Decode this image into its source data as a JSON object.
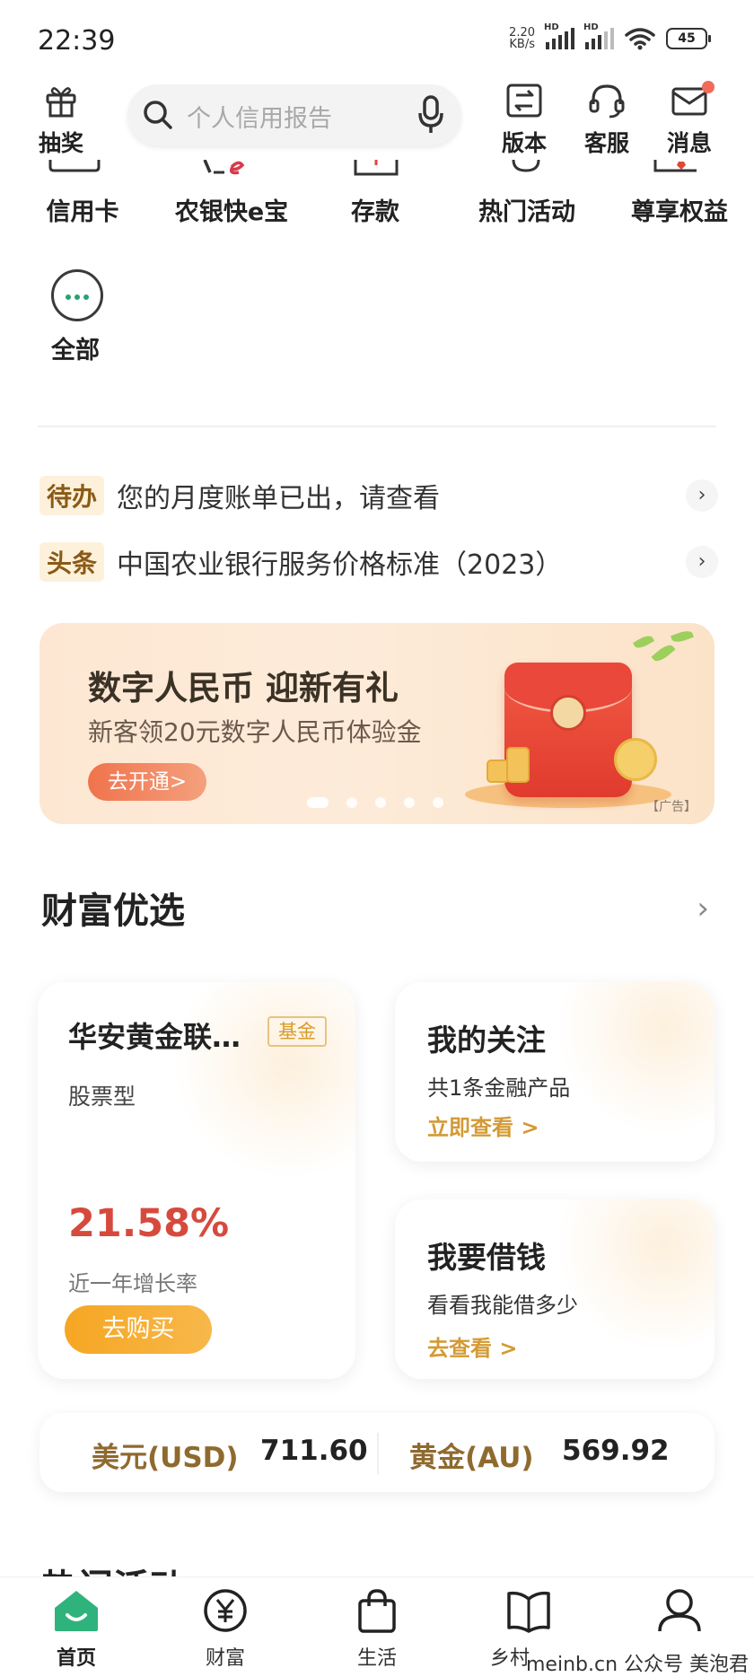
{
  "status_bar": {
    "time": "22:39",
    "net_speed_value": "2.20",
    "net_speed_unit": "KB/s",
    "hd1": "HD",
    "hd2": "HD",
    "battery": "45"
  },
  "header": {
    "lottery_label": "抽奖",
    "search_placeholder": "个人信用报告",
    "version_label": "版本",
    "service_label": "客服",
    "message_label": "消息",
    "message_has_dot": true
  },
  "quick_menu": {
    "items": [
      {
        "label": "信用卡"
      },
      {
        "label": "农银快e宝"
      },
      {
        "label": "存款"
      },
      {
        "label": "热门活动"
      },
      {
        "label": "尊享权益"
      }
    ],
    "all_label": "全部"
  },
  "notices": [
    {
      "tag": "待办",
      "text": "您的月度账单已出，请查看"
    },
    {
      "tag": "头条",
      "text": "中国农业银行服务价格标准（2023）"
    }
  ],
  "banner": {
    "title": "数字人民币 迎新有礼",
    "subtitle": "新客领20元数字人民币体验金",
    "button": "去开通>",
    "ad_tag": "【广告】",
    "pages": 5,
    "active_page": 1
  },
  "wealth": {
    "section_title": "财富优选",
    "fund": {
      "name": "华安黄金联…",
      "tag": "基金",
      "type": "股票型",
      "rate": "21.58%",
      "rate_label": "近一年增长率",
      "button": "去购买"
    },
    "watch": {
      "title": "我的关注",
      "subtitle": "共1条金融产品",
      "link": "立即查看 >"
    },
    "loan": {
      "title": "我要借钱",
      "subtitle": "看看我能借多少",
      "link": "去查看 >"
    }
  },
  "rates": {
    "usd_label": "美元(USD)",
    "usd_value": "711.60",
    "gold_label": "黄金(AU)",
    "gold_value": "569.92"
  },
  "next_section_title": "热门活动",
  "tabbar": {
    "tabs": [
      {
        "label": "首页"
      },
      {
        "label": "财富"
      },
      {
        "label": "生活"
      },
      {
        "label": "乡村"
      },
      {
        "label": "我的"
      }
    ],
    "active_index": 0
  },
  "watermark": "meinb.cn 公众号 美泡君",
  "colors": {
    "brand_green": "#26a36f",
    "accent_orange": "#f6a623",
    "rate_red": "#d64a3e",
    "gold_text": "#8f6a2f"
  }
}
